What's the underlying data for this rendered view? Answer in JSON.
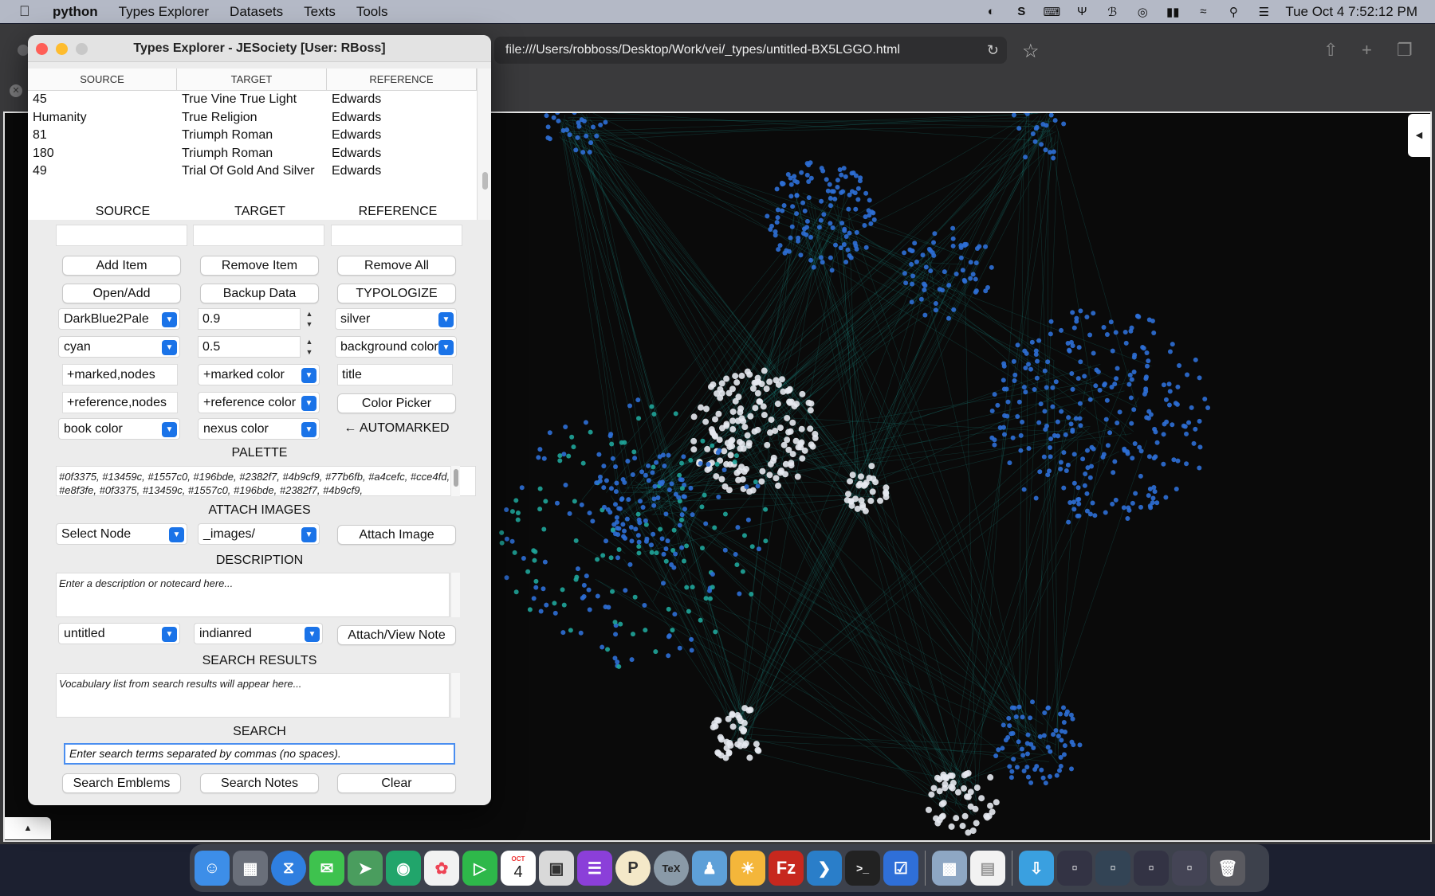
{
  "menubar": {
    "app_name": "python",
    "menus": [
      "Types Explorer",
      "Datasets",
      "Texts",
      "Tools"
    ],
    "clock": "Tue Oct 4  7:52:12 PM"
  },
  "browser": {
    "url": "file:///Users/robboss/Desktop/Work/vei/_types/untitled-BX5LGGO.html"
  },
  "window": {
    "title": "Types Explorer - JESociety [User: RBoss]"
  },
  "table": {
    "headers": [
      "SOURCE",
      "TARGET",
      "REFERENCE"
    ],
    "rows": [
      [
        "45",
        "True Vine True Light",
        "Edwards"
      ],
      [
        "Humanity",
        "True Religion",
        "Edwards"
      ],
      [
        "81",
        "Triumph Roman",
        "Edwards"
      ],
      [
        "180",
        "Triumph Roman",
        "Edwards"
      ],
      [
        "49",
        "Trial Of Gold And Silver",
        "Edwards"
      ]
    ]
  },
  "form": {
    "col_source": "SOURCE",
    "col_target": "TARGET",
    "col_reference": "REFERENCE",
    "add_item": "Add Item",
    "remove_item": "Remove Item",
    "remove_all": "Remove All",
    "open_add": "Open/Add",
    "backup_data": "Backup Data",
    "typologize": "TYPOLOGIZE",
    "scheme": "DarkBlue2Pale",
    "opacity_1": "0.9",
    "bg_option": "silver",
    "color_1": "cyan",
    "opacity_2": "0.5",
    "bg_color": "background color",
    "marked_nodes": "+marked,nodes",
    "marked_color": "+marked color",
    "title_field": "title",
    "reference_nodes": "+reference,nodes",
    "reference_color": "+reference color",
    "color_picker": "Color Picker",
    "book_color": "book color",
    "nexus_color": "nexus color",
    "automarked": "← AUTOMARKED",
    "palette_label": "PALETTE",
    "palette_text": "#0f3375, #13459c, #1557c0, #196bde, #2382f7, #4b9cf9, #77b6fb, #a4cefc, #cce4fd, #e8f3fe, #0f3375, #13459c, #1557c0, #196bde, #2382f7, #4b9cf9,",
    "attach_images_label": "ATTACH IMAGES",
    "select_node": "Select Node",
    "images_dir": "_images/",
    "attach_image": "Attach Image",
    "description_label": "DESCRIPTION",
    "description_placeholder": "Enter a description or notecard here...",
    "note_name": "untitled",
    "note_color": "indianred",
    "attach_view_note": "Attach/View Note",
    "search_results_label": "SEARCH RESULTS",
    "search_results_placeholder": "Vocabulary list from search results will appear here...",
    "search_label": "SEARCH",
    "search_placeholder": "Enter search terms separated by commas (no spaces).",
    "search_emblems": "Search Emblems",
    "search_notes": "Search Notes",
    "clear": "Clear"
  },
  "dock": {
    "calendar_month": "OCT",
    "calendar_day": "4"
  },
  "colors": {
    "node_blue": "#2e6fd6",
    "node_white": "#e6e9ef",
    "edge_teal": "#1fa59a",
    "accent": "#1a73e8"
  }
}
